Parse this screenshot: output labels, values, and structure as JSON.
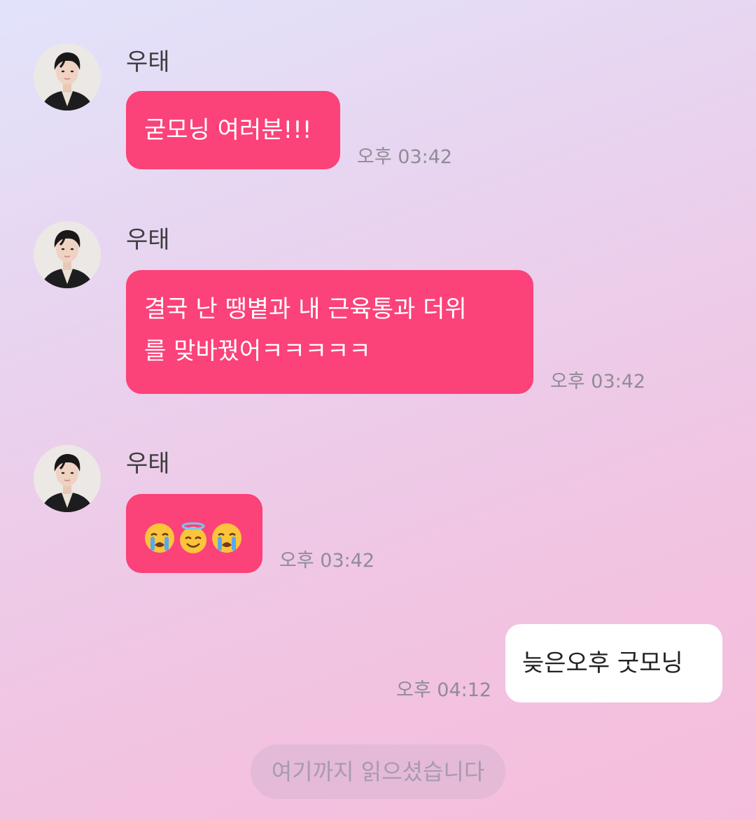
{
  "messages": [
    {
      "sender": "우태",
      "text": "굳모닝 여러분!!!",
      "time": "오후 03:42"
    },
    {
      "sender": "우태",
      "text_lines": [
        "결국 난 땡볕과 내 근육통과 더위",
        "를 맞바꿨어ㅋㅋㅋㅋㅋ"
      ],
      "time": "오후 03:42"
    },
    {
      "sender": "우태",
      "emojis": [
        "crying-face-icon",
        "smiling-face-with-halo-icon",
        "crying-face-icon"
      ],
      "time": "오후 03:42"
    },
    {
      "outgoing": true,
      "text": "늦은오후 굿모닝",
      "time": "오후 04:12"
    }
  ],
  "read_marker": "여기까지 읽으셨습니다",
  "colors": {
    "incoming_bubble": "#fb4279",
    "outgoing_bubble": "#ffffff",
    "timestamp": "#8f8c97"
  }
}
